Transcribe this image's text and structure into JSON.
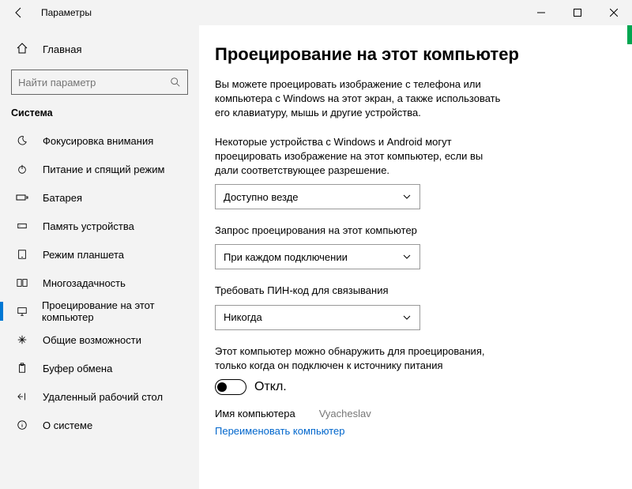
{
  "window": {
    "title": "Параметры"
  },
  "sidebar": {
    "home": "Главная",
    "searchPlaceholder": "Найти параметр",
    "sectionHeader": "Система",
    "items": [
      {
        "label": "Фокусировка внимания"
      },
      {
        "label": "Питание и спящий режим"
      },
      {
        "label": "Батарея"
      },
      {
        "label": "Память устройства"
      },
      {
        "label": "Режим планшета"
      },
      {
        "label": "Многозадачность"
      },
      {
        "label": "Проецирование на этот компьютер"
      },
      {
        "label": "Общие возможности"
      },
      {
        "label": "Буфер обмена"
      },
      {
        "label": "Удаленный рабочий стол"
      },
      {
        "label": "О системе"
      }
    ]
  },
  "main": {
    "title": "Проецирование на этот компьютер",
    "desc": "Вы можете проецировать изображение с телефона или компьютера с Windows на этот экран, а также использовать его клавиатуру, мышь и другие устройства.",
    "sect1Label": "Некоторые устройства с Windows и Android могут проецировать изображение на этот компьютер, если вы дали соответствующее разрешение.",
    "sect1Value": "Доступно везде",
    "sect2Label": "Запрос проецирования на этот компьютер",
    "sect2Value": "При каждом подключении",
    "sect3Label": "Требовать ПИН-код для связывания",
    "sect3Value": "Никогда",
    "sect4Label": "Этот компьютер можно обнаружить для проецирования, только когда он подключен к источнику питания",
    "toggleLabel": "Откл.",
    "computerNameLabel": "Имя компьютера",
    "computerNameValue": "Vyacheslav",
    "renameLink": "Переименовать компьютер"
  }
}
